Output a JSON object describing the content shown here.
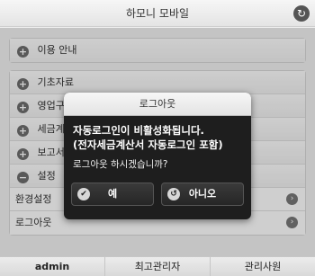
{
  "header": {
    "title": "하모니 모바일",
    "refresh_icon": "refresh-icon"
  },
  "menu": {
    "usage": "이용 안내",
    "items": [
      "기초자료",
      "영업구매",
      "세금계산서",
      "보고서",
      "설정"
    ],
    "settings_sub": [
      "환경설정",
      "로그아웃"
    ]
  },
  "dialog": {
    "title": "로그아웃",
    "message_line1": "자동로그인이 비활성화됩니다.",
    "message_line2": "(전자세금계산서 자동로그인 포함)",
    "question": "로그아웃 하시겠습니까?",
    "yes_label": "예",
    "no_label": "아니오"
  },
  "footer": {
    "user_id": "admin",
    "user_role": "최고관리자",
    "company": "관리사원"
  }
}
